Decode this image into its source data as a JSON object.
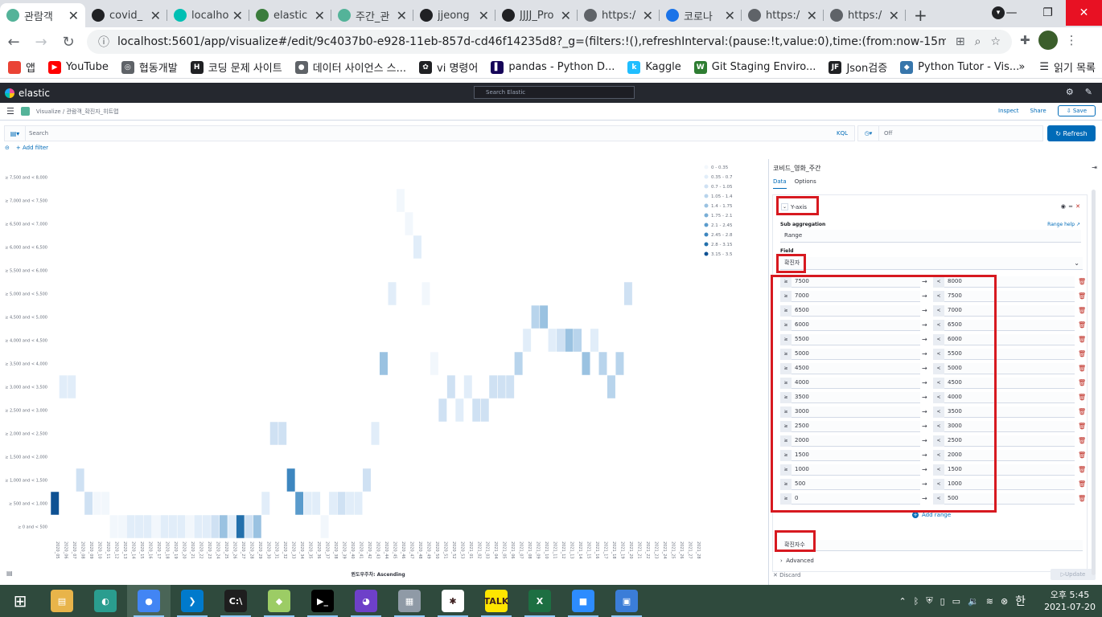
{
  "browser": {
    "tabs": [
      {
        "title": "관람객",
        "fav": "#54b399",
        "active": true
      },
      {
        "title": "covid_",
        "fav": "#202124"
      },
      {
        "title": "localho",
        "fav": "#00bfb3"
      },
      {
        "title": "elastic",
        "fav": "#3a7c3c"
      },
      {
        "title": "주간_관",
        "fav": "#54b399"
      },
      {
        "title": "jjeong",
        "fav": "#202124"
      },
      {
        "title": "JJJJ_Pro",
        "fav": "#202124"
      },
      {
        "title": "https:/",
        "fav": "#5f6368"
      },
      {
        "title": "코로나",
        "fav": "#1a73e8"
      },
      {
        "title": "https:/",
        "fav": "#5f6368"
      },
      {
        "title": "https:/",
        "fav": "#5f6368"
      }
    ],
    "new_tab": "+",
    "url": "localhost:5601/app/visualize#/edit/9c4037b0-e928-11eb-857d-cd46f14235d8?_g=(filters:!(),refreshInterval:(pause:!t,value:0),time:(from:now-15m,to:now))&_a=(...",
    "bookmarks": [
      {
        "label": "앱",
        "color": "#ea4335",
        "glyph": ""
      },
      {
        "label": "YouTube",
        "color": "#ff0000",
        "glyph": "▶"
      },
      {
        "label": "협동개발",
        "color": "#5f6368",
        "glyph": "◎"
      },
      {
        "label": "코딩 문제 사이트",
        "color": "#202124",
        "glyph": "H"
      },
      {
        "label": "데이터 사이언스 스...",
        "color": "#5f6368",
        "glyph": "●"
      },
      {
        "label": "vi 명령어",
        "color": "#202124",
        "glyph": "✿"
      },
      {
        "label": "pandas - Python D...",
        "color": "#150458",
        "glyph": "▌"
      },
      {
        "label": "Kaggle",
        "color": "#20beff",
        "glyph": "k"
      },
      {
        "label": "Git Staging Enviro...",
        "color": "#2e7d32",
        "glyph": "W"
      },
      {
        "label": "Json검증",
        "color": "#202124",
        "glyph": "JF"
      },
      {
        "label": "Python Tutor - Vis...",
        "color": "#3776ab",
        "glyph": "◆"
      }
    ],
    "bookmarks_more": "»",
    "reading_list": "읽기 목록"
  },
  "kibana": {
    "logo": "elastic",
    "search_placeholder": "Search Elastic",
    "breadcrumb": "Visualize  /  관람객_확진자_히트맵",
    "inspect": "Inspect",
    "share": "Share",
    "save": "Save",
    "query_placeholder": "Search",
    "kql": "KQL",
    "time_value": "Off",
    "refresh": "Refresh",
    "add_filter": "+ Add filter"
  },
  "chart_data": {
    "type": "heatmap",
    "xlabel": "윈도우주차: Ascending",
    "y_categories": [
      "≥ 0 and < 500",
      "≥ 500 and < 1,000",
      "≥ 1,000 and < 1,500",
      "≥ 1,500 and < 2,000",
      "≥ 2,000 and < 2,500",
      "≥ 2,500 and < 3,000",
      "≥ 3,000 and < 3,500",
      "≥ 3,500 and < 4,000",
      "≥ 4,000 and < 4,500",
      "≥ 4,500 and < 5,000",
      "≥ 5,000 and < 5,500",
      "≥ 5,500 and < 6,000",
      "≥ 6,000 and < 6,500",
      "≥ 6,500 and < 7,000",
      "≥ 7,000 and < 7,500",
      "≥ 7,500 and < 8,000"
    ],
    "x_categories": [
      "2020_05",
      "2020_06",
      "2020_07",
      "2020_08",
      "2020_09",
      "2020_10",
      "2020_11",
      "2020_12",
      "2020_13",
      "2020_14",
      "2020_15",
      "2020_16",
      "2020_17",
      "2020_18",
      "2020_19",
      "2020_20",
      "2020_21",
      "2020_22",
      "2020_23",
      "2020_24",
      "2020_25",
      "2020_26",
      "2020_27",
      "2020_28",
      "2020_29",
      "2020_30",
      "2020_31",
      "2020_32",
      "2020_33",
      "2020_34",
      "2020_35",
      "2020_36",
      "2020_37",
      "2020_38",
      "2020_39",
      "2020_40",
      "2020_41",
      "2020_42",
      "2020_43",
      "2020_44",
      "2020_45",
      "2020_46",
      "2020_47",
      "2020_48",
      "2020_49",
      "2020_50",
      "2020_51",
      "2020_52",
      "2020_53",
      "2021_01",
      "2021_02",
      "2021_03",
      "2021_04",
      "2021_05",
      "2021_06",
      "2021_07",
      "2021_08",
      "2021_09",
      "2021_10",
      "2021_11",
      "2021_12",
      "2021_13",
      "2021_14",
      "2021_15",
      "2021_16",
      "2021_17",
      "2021_18",
      "2021_19",
      "2021_20",
      "2021_21",
      "2021_22",
      "2021_23",
      "2021_24",
      "2021_25",
      "2021_26",
      "2021_27",
      "2021_28"
    ],
    "cells": [
      [
        0,
        1,
        3.3
      ],
      [
        1,
        6,
        0.5
      ],
      [
        2,
        6,
        0.5
      ],
      [
        3,
        2,
        0.7
      ],
      [
        4,
        1,
        0.8
      ],
      [
        5,
        1,
        0.3
      ],
      [
        6,
        1,
        0.3
      ],
      [
        7,
        0,
        0.2
      ],
      [
        8,
        0,
        0.3
      ],
      [
        9,
        0,
        0.4
      ],
      [
        10,
        0,
        0.5
      ],
      [
        11,
        0,
        0.5
      ],
      [
        12,
        0,
        0.3
      ],
      [
        13,
        0,
        0.5
      ],
      [
        14,
        0,
        0.5
      ],
      [
        15,
        0,
        0.4
      ],
      [
        16,
        0,
        0.3
      ],
      [
        17,
        0,
        0.5
      ],
      [
        18,
        0,
        0.5
      ],
      [
        19,
        0,
        1.0
      ],
      [
        20,
        0,
        1.4
      ],
      [
        21,
        0,
        0.6
      ],
      [
        22,
        0,
        3.0
      ],
      [
        23,
        0,
        1.0
      ],
      [
        24,
        0,
        1.6
      ],
      [
        25,
        1,
        0.5
      ],
      [
        26,
        4,
        0.7
      ],
      [
        27,
        4,
        0.8
      ],
      [
        28,
        2,
        2.6
      ],
      [
        29,
        1,
        2.2
      ],
      [
        30,
        1,
        0.6
      ],
      [
        31,
        1,
        0.4
      ],
      [
        32,
        0,
        0.3
      ],
      [
        33,
        1,
        0.6
      ],
      [
        34,
        1,
        0.7
      ],
      [
        35,
        1,
        0.4
      ],
      [
        36,
        1,
        0.6
      ],
      [
        37,
        2,
        0.7
      ],
      [
        38,
        4,
        0.6
      ],
      [
        39,
        7,
        1.6
      ],
      [
        40,
        10,
        0.5
      ],
      [
        41,
        14,
        0.3
      ],
      [
        42,
        13,
        0.2
      ],
      [
        43,
        12,
        0.4
      ],
      [
        44,
        10,
        0.2
      ],
      [
        45,
        7,
        0.2
      ],
      [
        46,
        5,
        0.7
      ],
      [
        47,
        6,
        0.8
      ],
      [
        48,
        5,
        0.6
      ],
      [
        49,
        6,
        0.4
      ],
      [
        50,
        5,
        0.7
      ],
      [
        51,
        5,
        0.8
      ],
      [
        52,
        6,
        0.7
      ],
      [
        53,
        6,
        0.8
      ],
      [
        54,
        6,
        0.7
      ],
      [
        55,
        7,
        1.1
      ],
      [
        56,
        8,
        0.4
      ],
      [
        57,
        9,
        1.3
      ],
      [
        58,
        9,
        1.6
      ],
      [
        59,
        8,
        0.5
      ],
      [
        60,
        8,
        0.8
      ],
      [
        61,
        8,
        1.4
      ],
      [
        62,
        8,
        1.2
      ],
      [
        63,
        7,
        1.6
      ],
      [
        64,
        8,
        0.6
      ],
      [
        65,
        7,
        1.3
      ],
      [
        66,
        6,
        1.2
      ],
      [
        67,
        7,
        1.1
      ],
      [
        68,
        10,
        0.9
      ]
    ],
    "legend": [
      "0 - 0.35",
      "0.35 - 0.7",
      "0.7 - 1.05",
      "1.05 - 1.4",
      "1.4 - 1.75",
      "1.75 - 2.1",
      "2.1 - 2.45",
      "2.45 - 2.8",
      "2.8 - 3.15",
      "3.15 - 3.5"
    ],
    "legend_colors": [
      "#f2f7fc",
      "#e1edf9",
      "#cfe1f3",
      "#b8d4ec",
      "#9ac2e1",
      "#79aed6",
      "#5a9bcc",
      "#3d86bf",
      "#2370ac",
      "#0e5193"
    ],
    "legend_placement": "top-right"
  },
  "editor": {
    "title": "코비드_영화_주간",
    "tab_data": "Data",
    "tab_options": "Options",
    "yaxis_label": "Y-axis",
    "sub_agg_label": "Sub aggregation",
    "range_help": "Range help",
    "sub_agg_value": "Range",
    "field_label": "Field",
    "field_value": "확진자",
    "ranges": [
      {
        "from": "7500",
        "to": "8000"
      },
      {
        "from": "7000",
        "to": "7500"
      },
      {
        "from": "6500",
        "to": "7000"
      },
      {
        "from": "6000",
        "to": "6500"
      },
      {
        "from": "5500",
        "to": "6000"
      },
      {
        "from": "5000",
        "to": "5500"
      },
      {
        "from": "4500",
        "to": "5000"
      },
      {
        "from": "4000",
        "to": "4500"
      },
      {
        "from": "3500",
        "to": "4000"
      },
      {
        "from": "3000",
        "to": "3500"
      },
      {
        "from": "2500",
        "to": "3000"
      },
      {
        "from": "2000",
        "to": "2500"
      },
      {
        "from": "1500",
        "to": "2000"
      },
      {
        "from": "1000",
        "to": "1500"
      },
      {
        "from": "500",
        "to": "1000"
      },
      {
        "from": "0",
        "to": "500"
      }
    ],
    "gte": "≥",
    "lt": "<",
    "add_range": "Add range",
    "custom_label_value": "확진자수",
    "advanced": "Advanced",
    "discard": "Discard",
    "update": "Update"
  },
  "taskbar": {
    "apps": [
      {
        "name": "file-explorer",
        "color": "#e8b44a",
        "glyph": "▤",
        "running": false
      },
      {
        "name": "app-whale",
        "color": "#2a9d8f",
        "glyph": "◐",
        "running": false
      },
      {
        "name": "chrome",
        "color": "#4285f4",
        "glyph": "●",
        "running": true,
        "active": true
      },
      {
        "name": "vscode",
        "color": "#007acc",
        "glyph": "❯",
        "running": true
      },
      {
        "name": "terminal",
        "color": "#1e1e1e",
        "glyph": "C:\\",
        "running": true
      },
      {
        "name": "folder-app",
        "color": "#9ccc65",
        "glyph": "◆",
        "running": true
      },
      {
        "name": "cmd",
        "color": "#000000",
        "glyph": "▶_",
        "running": true
      },
      {
        "name": "github-desktop",
        "color": "#6e40c9",
        "glyph": "◕",
        "running": true
      },
      {
        "name": "calculator",
        "color": "#8f9aa6",
        "glyph": "▦",
        "running": true
      },
      {
        "name": "slack",
        "color": "#ffffff",
        "glyph": "✱",
        "running": true
      },
      {
        "name": "kakaotalk",
        "color": "#fee500",
        "glyph": "TALK",
        "running": true
      },
      {
        "name": "excel",
        "color": "#1d6f42",
        "glyph": "X",
        "running": true
      },
      {
        "name": "zoom",
        "color": "#2d8cff",
        "glyph": "■",
        "running": true
      },
      {
        "name": "photos",
        "color": "#3b7dd8",
        "glyph": "▣",
        "running": true
      }
    ],
    "ime": "한",
    "time": "오후 5:45",
    "date": "2021-07-20"
  }
}
